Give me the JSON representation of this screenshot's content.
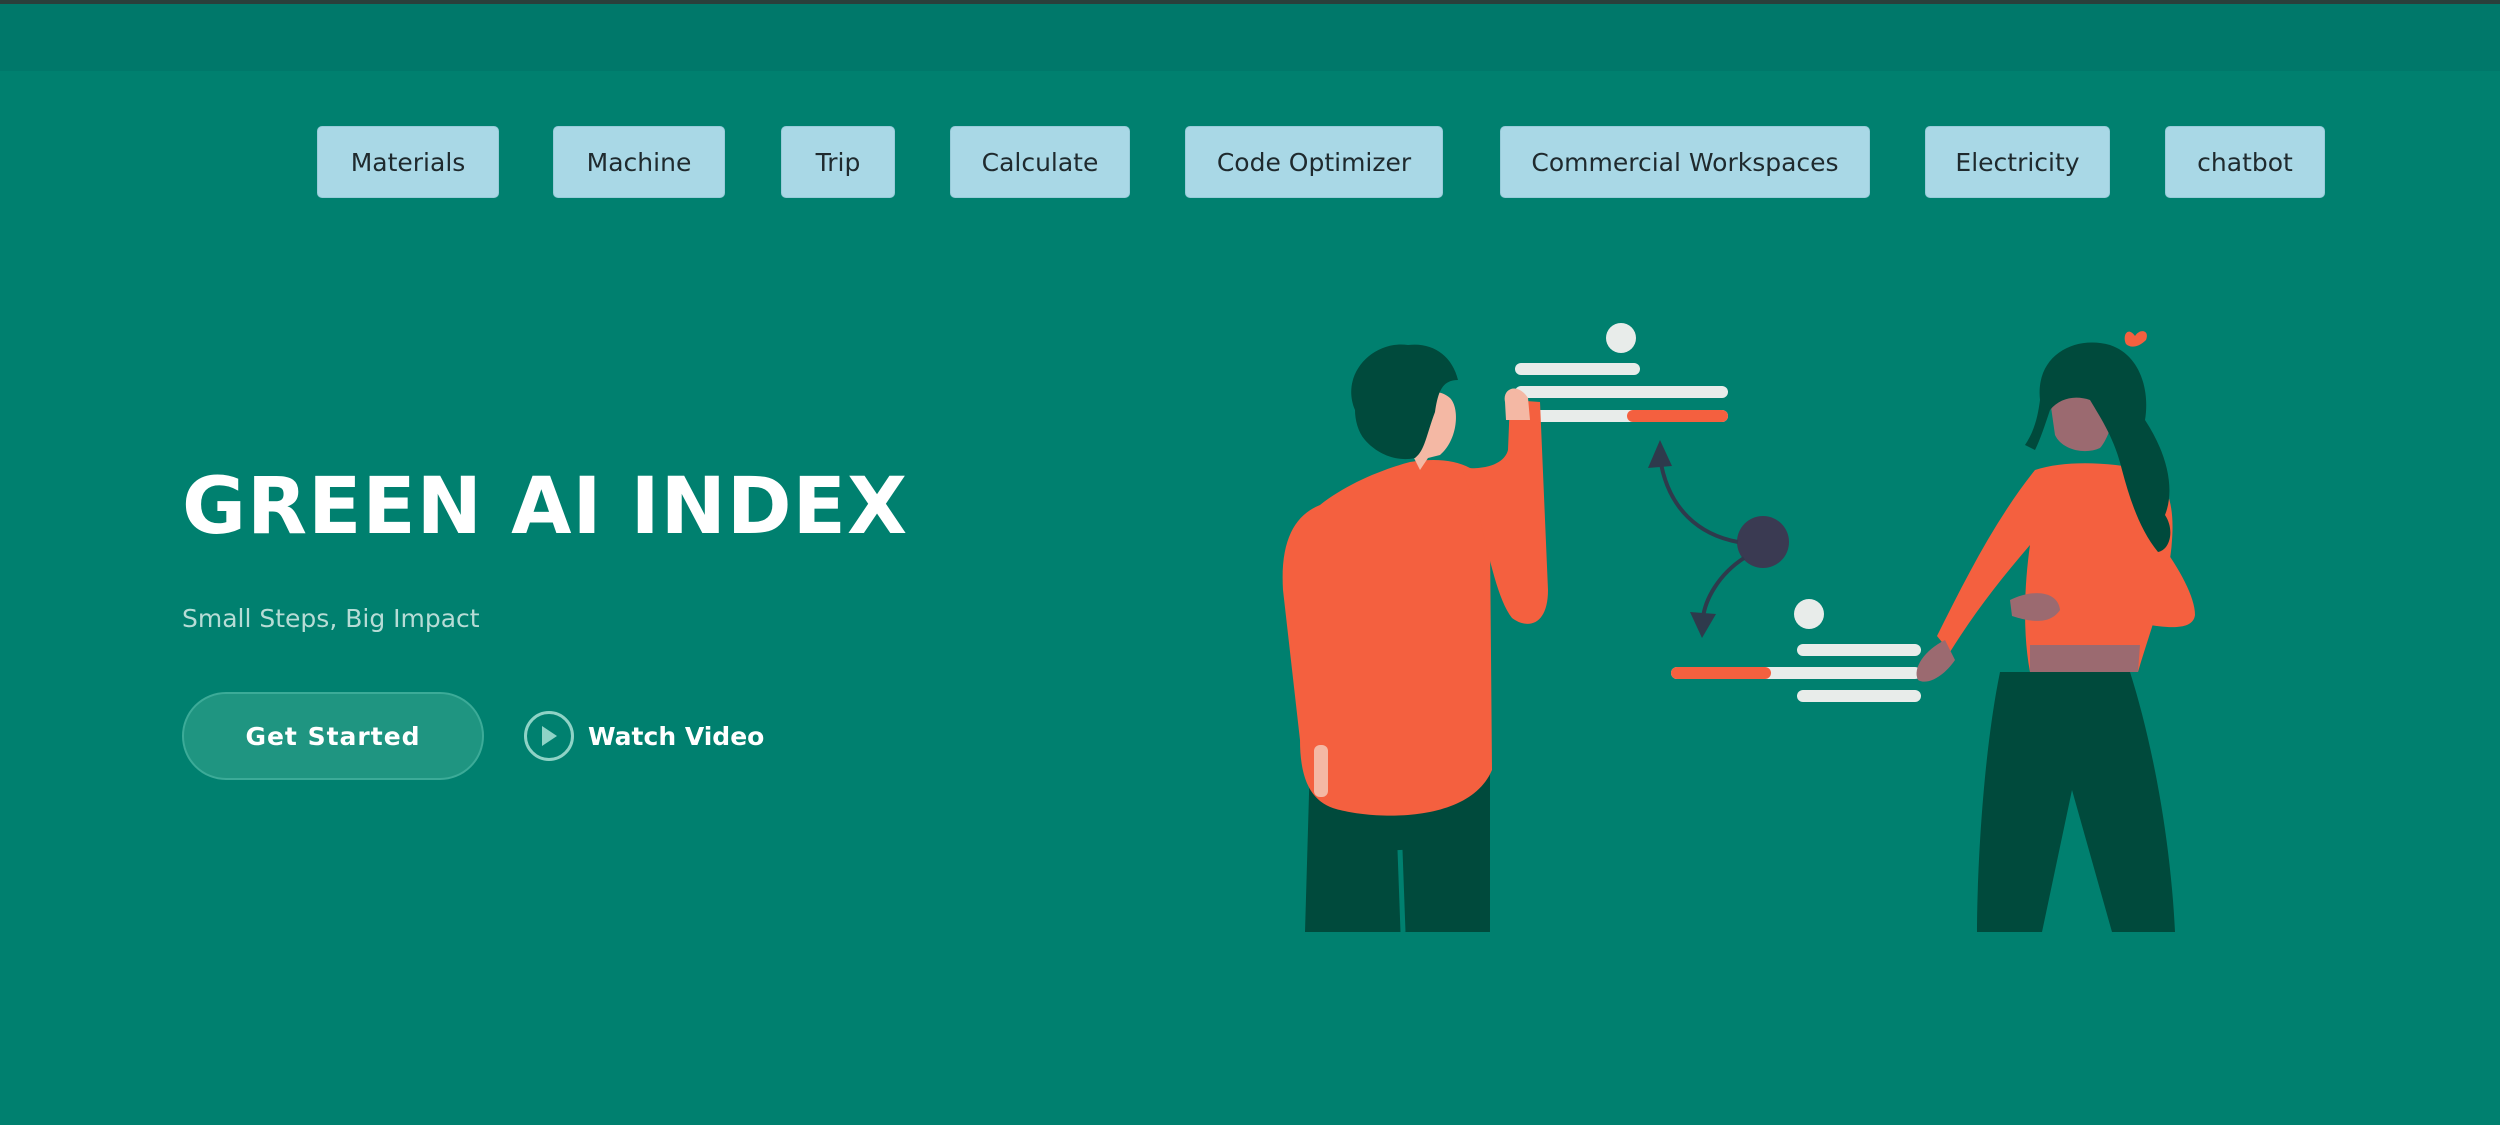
{
  "nav": {
    "items": [
      {
        "label": "Materials"
      },
      {
        "label": "Machine"
      },
      {
        "label": "Trip"
      },
      {
        "label": "Calculate"
      },
      {
        "label": "Code Optimizer"
      },
      {
        "label": "Commercial Workspaces"
      },
      {
        "label": "Electricity"
      },
      {
        "label": "chatbot"
      }
    ]
  },
  "hero": {
    "title": "GREEN AI INDEX",
    "subtitle": "Small Steps, Big Impact",
    "cta_primary": "Get Started",
    "cta_secondary": "Watch Video"
  },
  "icons": {
    "play": "play-icon"
  },
  "colors": {
    "background": "#00806f",
    "header_strip": "#00786a",
    "nav_button": "#a9d8e6",
    "accent": "#f4603f",
    "dark_green": "#004a3c"
  }
}
